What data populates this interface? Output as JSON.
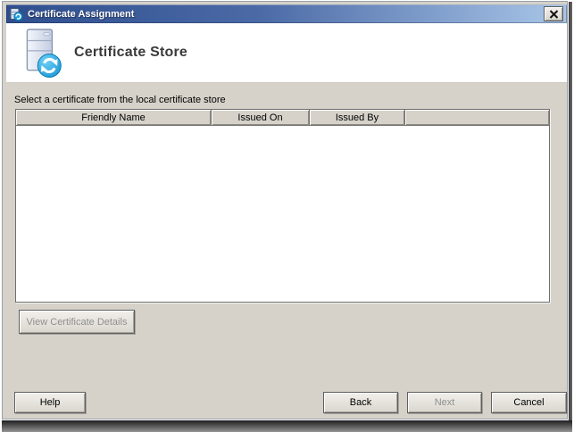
{
  "window": {
    "title": "Certificate Assignment"
  },
  "icons": {
    "titlebar": "server-sync-icon",
    "header": "server-sync-icon",
    "close": "close-x"
  },
  "header": {
    "title": "Certificate Store"
  },
  "content": {
    "instruction": "Select a certificate from the local certificate store",
    "table": {
      "columns": [
        "Friendly Name",
        "Issued On",
        "Issued By",
        ""
      ],
      "rows": []
    },
    "buttons": {
      "view_details": "View Certificate Details"
    }
  },
  "footer": {
    "help": "Help",
    "back": "Back",
    "next": "Next",
    "cancel": "Cancel"
  },
  "state": {
    "view_details_enabled": false,
    "back_enabled": true,
    "next_enabled": false
  },
  "colors": {
    "titlebar_gradient_left": "#2E4E8E",
    "titlebar_gradient_right": "#A9C6E8",
    "content_bg": "#D6D2CA",
    "header_bg": "#FFFFFF",
    "disabled_text": "#8F8F8F",
    "sync_icon_blue": "#149FDD"
  }
}
